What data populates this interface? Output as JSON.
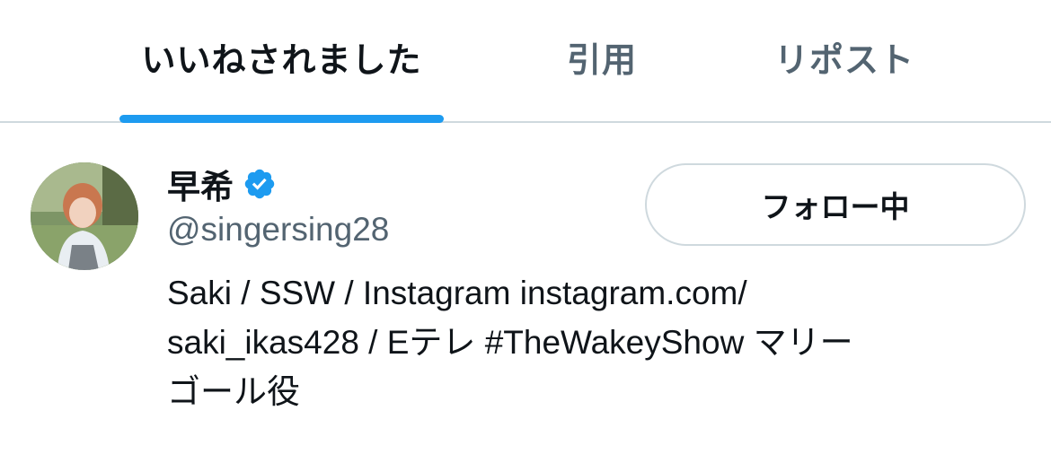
{
  "tabs": {
    "liked": "いいねされました",
    "quotes": "引用",
    "reposts": "リポスト",
    "active": "liked"
  },
  "user": {
    "display_name": "早希",
    "verified": true,
    "handle": "@singersing28",
    "bio_lines": [
      "Saki / SSW / Instagram instagram.com/",
      "saki_ikas428 / Eテレ #TheWakeyShow マリー",
      "ゴール役"
    ],
    "follow_button_label": "フォロー中"
  },
  "colors": {
    "accent": "#1d9bf0",
    "text_primary": "#0f1419",
    "text_secondary": "#536471",
    "border": "#cfd9de"
  }
}
